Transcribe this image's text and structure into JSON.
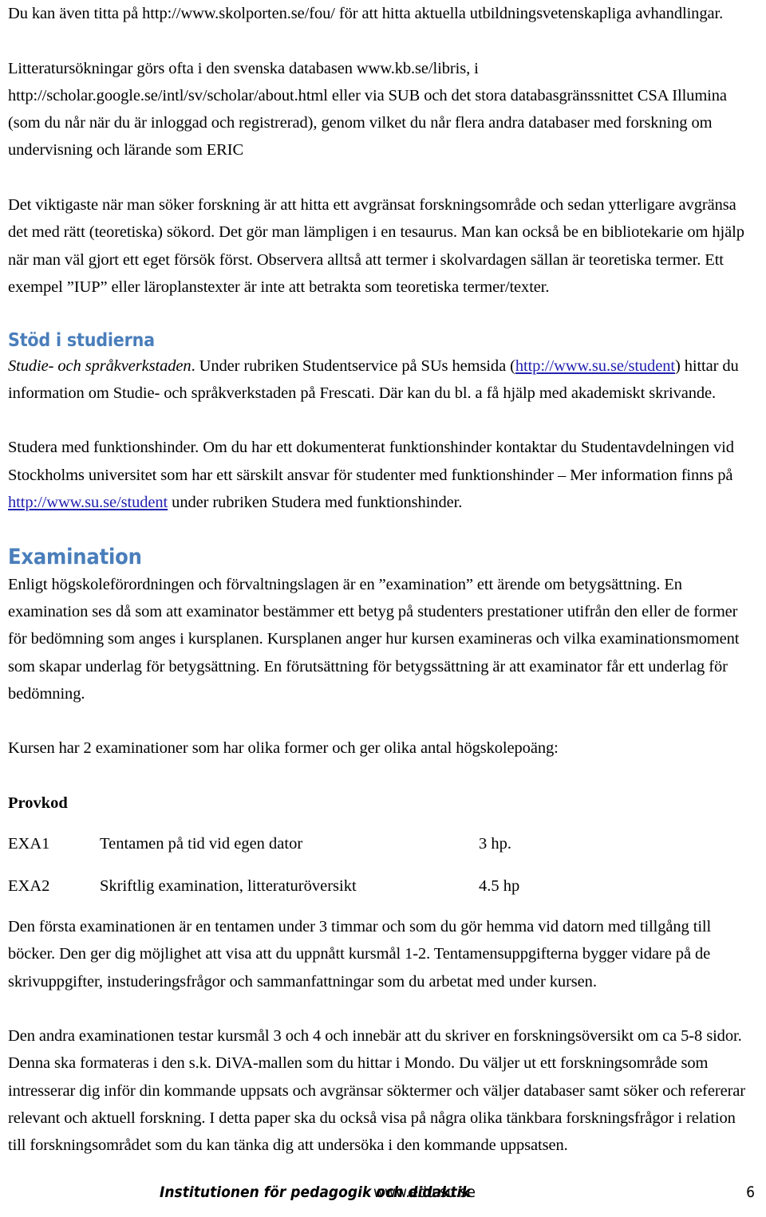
{
  "document": {
    "page_number": "6",
    "heading_color": "#4a7ebb",
    "link_color": "#2121b0",
    "body_color": "#000000"
  },
  "intro": {
    "para1": "Du kan även titta på http://www.skolporten.se/fou/ för att hitta aktuella utbildningsvetenskapliga avhandlingar.",
    "para2_a": "Litteratursökningar görs ofta i den svenska databasen www.kb.se/libris, i http://scholar.google.se/intl/sv/scholar/about.html eller via SUB och det stora databasgränssnittet CSA Illumina (som du når när du är inloggad och registrerad), genom vilket du når flera andra databaser med forskning om undervisning och lärande som ERIC",
    "para3": "Det viktigaste när man söker forskning är att hitta ett avgränsat forskningsområde och sedan ytterligare avgränsa det med rätt (teoretiska) sökord. Det gör man lämpligen i en tesaurus. Man kan också be en bibliotekarie om hjälp när man väl gjort ett eget försök först. Observera alltså att termer i skolvardagen sällan är teoretiska termer. Ett exempel ”IUP” eller läroplanstexter är inte att betrakta som teoretiska termer/texter."
  },
  "stod": {
    "heading": "Stöd i studierna",
    "para1_italic": "Studie- och språkverkstaden",
    "para1_rest_a": ". Under rubriken Studentservice på SUs hemsida (",
    "para1_link": "http://www.su.se/student",
    "para1_rest_b": ") hittar du information om Studie- och språkverkstaden på Frescati. Där kan du bl. a få hjälp med akademiskt skrivande.",
    "para2_a": "Studera med funktionshinder. Om du har ett dokumenterat funktionshinder kontaktar du Studentavdelningen vid Stockholms universitet som har ett särskilt ansvar för studenter med funktionshinder – Mer information finns på ",
    "para2_link": "http://www.su.se/student",
    "para2_b": " under rubriken Studera med funktionshinder."
  },
  "examination": {
    "heading": "Examination",
    "para1": "Enligt högskoleförordningen och förvaltningslagen är en ”examination” ett ärende om betygsättning. En examination ses då som att examinator bestämmer ett betyg på studenters prestationer utifrån den eller de former för bedömning som anges i kursplanen. Kursplanen anger hur kursen examineras och vilka examinationsmoment som skapar underlag för betygsättning. En förutsättning för betygssättning är att examinator får ett underlag för bedömning.",
    "para2": "Kursen har 2 examinationer som har olika former och ger olika antal högskolepoäng:",
    "table_header": "Provkod",
    "rows": [
      {
        "code": "EXA1",
        "description": "Tentamen på tid vid egen dator",
        "credits": "3 hp."
      },
      {
        "code": "EXA2",
        "description": "Skriftlig examination, litteraturöversikt",
        "credits": "4.5 hp"
      }
    ],
    "para3": "Den första examinationen är en tentamen under 3 timmar och som du gör hemma vid datorn med tillgång till böcker. Den ger dig möjlighet att visa att du uppnått kursmål 1-2. Tentamensuppgifterna bygger vidare på de skrivuppgifter, instuderingsfrågor och sammanfattningar som du arbetat med under kursen.",
    "para4": "Den andra examinationen testar kursmål 3 och 4 och innebär att du skriver en forskningsöversikt om ca 5-8 sidor. Denna ska formateras i den s.k. DiVA-mallen som du hittar i Mondo. Du väljer ut ett forskningsområde som intresserar dig inför din kommande uppsats och avgränsar söktermer och väljer databaser samt söker och refererar relevant och aktuell forskning. I detta paper ska du också visa på några olika tänkbara forskningsfrågor i relation till forskningsområdet som du kan tänka dig att undersöka i den kommande uppsatsen."
  },
  "footer": {
    "department": "Institutionen för pedagogik och didaktik",
    "url": "www.edu.su.se",
    "page": "6"
  }
}
